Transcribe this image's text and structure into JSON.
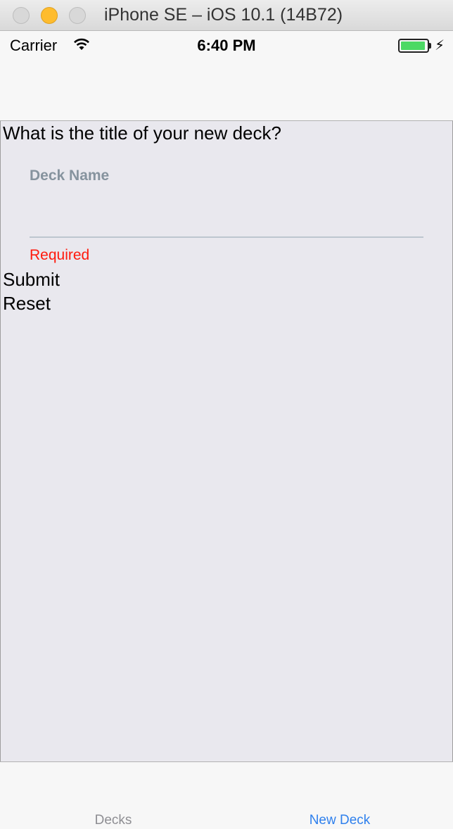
{
  "window": {
    "title": "iPhone SE – iOS 10.1 (14B72)"
  },
  "status_bar": {
    "carrier": "Carrier",
    "time": "6:40 PM",
    "battery_color": "#4cd964"
  },
  "form": {
    "question": "What is the title of your new deck?",
    "field_label": "Deck Name",
    "field_value": "",
    "field_error": "Required",
    "submit_label": "Submit",
    "reset_label": "Reset"
  },
  "tab_bar": {
    "tabs": [
      {
        "label": "Decks",
        "active": false
      },
      {
        "label": "New Deck",
        "active": true
      }
    ],
    "active_color": "#2f80ed",
    "inactive_color": "#8e8e93"
  },
  "colors": {
    "background": "#e9e8ee",
    "error": "#ff190c",
    "label": "#86939e"
  }
}
